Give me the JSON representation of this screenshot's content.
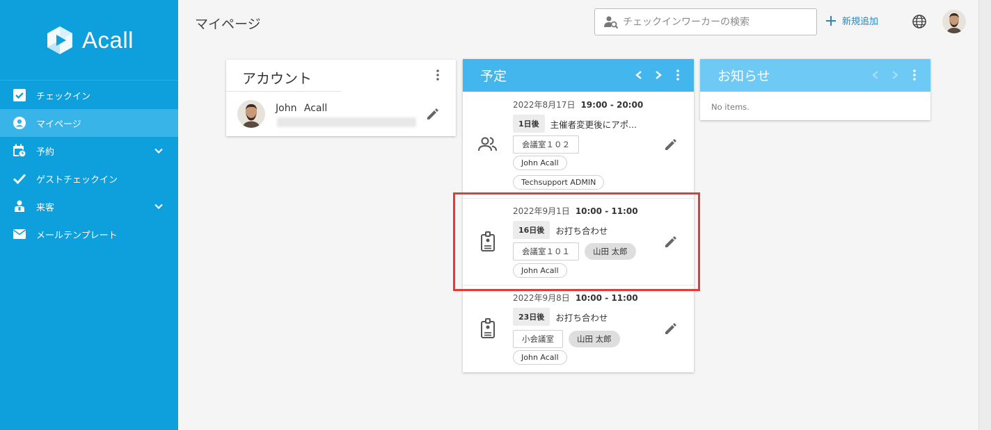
{
  "sidebar": {
    "logo_text": "Acall",
    "items": [
      {
        "label": "チェックイン",
        "icon": "checkbox-icon"
      },
      {
        "label": "マイページ",
        "icon": "account-circle-icon",
        "active": true
      },
      {
        "label": "予約",
        "icon": "calendar-clock-icon",
        "expandable": true
      },
      {
        "label": "ゲストチェックイン",
        "icon": "check-icon"
      },
      {
        "label": "来客",
        "icon": "visitor-icon",
        "expandable": true
      },
      {
        "label": "メールテンプレート",
        "icon": "mail-icon"
      }
    ]
  },
  "header": {
    "title": "マイページ",
    "search_placeholder": "チェックインワーカーの検索",
    "add_label": "新規追加"
  },
  "account": {
    "title": "アカウント",
    "name": "John Acall"
  },
  "schedule": {
    "title": "予定",
    "events": [
      {
        "date": "2022年8月17日",
        "time": "19:00 - 20:00",
        "days": "1日後",
        "title": "主催者変更後にアポ...",
        "room": "会議室１０２",
        "people": [
          "John Acall",
          "Techsupport ADMIN"
        ],
        "icon": "people-icon"
      },
      {
        "date": "2022年9月1日",
        "time": "10:00 - 11:00",
        "days": "16日後",
        "title": "お打ち合わせ",
        "room": "会議室１０１",
        "guest": "山田 太郎",
        "people": [
          "John Acall"
        ],
        "icon": "badge-icon",
        "highlighted": true
      },
      {
        "date": "2022年9月8日",
        "time": "10:00 - 11:00",
        "days": "23日後",
        "title": "お打ち合わせ",
        "room": "小会議室",
        "guest": "山田 太郎",
        "people": [
          "John Acall"
        ],
        "icon": "badge-icon"
      }
    ]
  },
  "news": {
    "title": "お知らせ",
    "empty_text": "No items."
  },
  "colors": {
    "sidebar": "#0ea0dd",
    "sidebar_active": "#39b4e8",
    "schedule_header": "#43b6ee",
    "news_header": "#6ec9f5",
    "accent": "#1e88c8",
    "highlight": "#e53935"
  }
}
